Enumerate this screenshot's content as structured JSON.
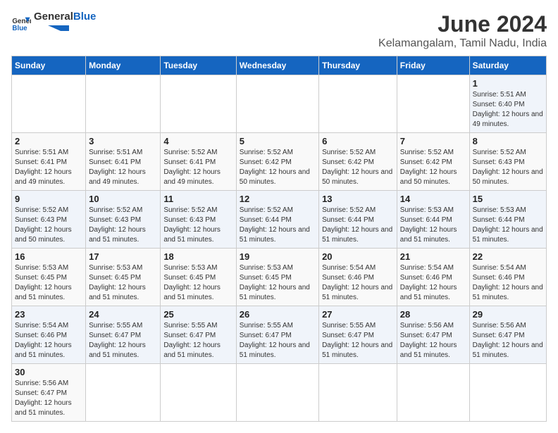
{
  "logo": {
    "text_general": "General",
    "text_blue": "Blue"
  },
  "title": "June 2024",
  "subtitle": "Kelamangalam, Tamil Nadu, India",
  "days_of_week": [
    "Sunday",
    "Monday",
    "Tuesday",
    "Wednesday",
    "Thursday",
    "Friday",
    "Saturday"
  ],
  "weeks": [
    [
      {
        "day": "",
        "info": ""
      },
      {
        "day": "",
        "info": ""
      },
      {
        "day": "",
        "info": ""
      },
      {
        "day": "",
        "info": ""
      },
      {
        "day": "",
        "info": ""
      },
      {
        "day": "",
        "info": ""
      },
      {
        "day": "1",
        "info": "Sunrise: 5:51 AM\nSunset: 6:40 PM\nDaylight: 12 hours and 49 minutes."
      }
    ],
    [
      {
        "day": "2",
        "info": "Sunrise: 5:51 AM\nSunset: 6:41 PM\nDaylight: 12 hours and 49 minutes."
      },
      {
        "day": "3",
        "info": "Sunrise: 5:51 AM\nSunset: 6:41 PM\nDaylight: 12 hours and 49 minutes."
      },
      {
        "day": "4",
        "info": "Sunrise: 5:52 AM\nSunset: 6:41 PM\nDaylight: 12 hours and 49 minutes."
      },
      {
        "day": "5",
        "info": "Sunrise: 5:52 AM\nSunset: 6:42 PM\nDaylight: 12 hours and 50 minutes."
      },
      {
        "day": "6",
        "info": "Sunrise: 5:52 AM\nSunset: 6:42 PM\nDaylight: 12 hours and 50 minutes."
      },
      {
        "day": "7",
        "info": "Sunrise: 5:52 AM\nSunset: 6:42 PM\nDaylight: 12 hours and 50 minutes."
      },
      {
        "day": "8",
        "info": "Sunrise: 5:52 AM\nSunset: 6:43 PM\nDaylight: 12 hours and 50 minutes."
      }
    ],
    [
      {
        "day": "9",
        "info": "Sunrise: 5:52 AM\nSunset: 6:43 PM\nDaylight: 12 hours and 50 minutes."
      },
      {
        "day": "10",
        "info": "Sunrise: 5:52 AM\nSunset: 6:43 PM\nDaylight: 12 hours and 51 minutes."
      },
      {
        "day": "11",
        "info": "Sunrise: 5:52 AM\nSunset: 6:43 PM\nDaylight: 12 hours and 51 minutes."
      },
      {
        "day": "12",
        "info": "Sunrise: 5:52 AM\nSunset: 6:44 PM\nDaylight: 12 hours and 51 minutes."
      },
      {
        "day": "13",
        "info": "Sunrise: 5:52 AM\nSunset: 6:44 PM\nDaylight: 12 hours and 51 minutes."
      },
      {
        "day": "14",
        "info": "Sunrise: 5:53 AM\nSunset: 6:44 PM\nDaylight: 12 hours and 51 minutes."
      },
      {
        "day": "15",
        "info": "Sunrise: 5:53 AM\nSunset: 6:44 PM\nDaylight: 12 hours and 51 minutes."
      }
    ],
    [
      {
        "day": "16",
        "info": "Sunrise: 5:53 AM\nSunset: 6:45 PM\nDaylight: 12 hours and 51 minutes."
      },
      {
        "day": "17",
        "info": "Sunrise: 5:53 AM\nSunset: 6:45 PM\nDaylight: 12 hours and 51 minutes."
      },
      {
        "day": "18",
        "info": "Sunrise: 5:53 AM\nSunset: 6:45 PM\nDaylight: 12 hours and 51 minutes."
      },
      {
        "day": "19",
        "info": "Sunrise: 5:53 AM\nSunset: 6:45 PM\nDaylight: 12 hours and 51 minutes."
      },
      {
        "day": "20",
        "info": "Sunrise: 5:54 AM\nSunset: 6:46 PM\nDaylight: 12 hours and 51 minutes."
      },
      {
        "day": "21",
        "info": "Sunrise: 5:54 AM\nSunset: 6:46 PM\nDaylight: 12 hours and 51 minutes."
      },
      {
        "day": "22",
        "info": "Sunrise: 5:54 AM\nSunset: 6:46 PM\nDaylight: 12 hours and 51 minutes."
      }
    ],
    [
      {
        "day": "23",
        "info": "Sunrise: 5:54 AM\nSunset: 6:46 PM\nDaylight: 12 hours and 51 minutes."
      },
      {
        "day": "24",
        "info": "Sunrise: 5:55 AM\nSunset: 6:47 PM\nDaylight: 12 hours and 51 minutes."
      },
      {
        "day": "25",
        "info": "Sunrise: 5:55 AM\nSunset: 6:47 PM\nDaylight: 12 hours and 51 minutes."
      },
      {
        "day": "26",
        "info": "Sunrise: 5:55 AM\nSunset: 6:47 PM\nDaylight: 12 hours and 51 minutes."
      },
      {
        "day": "27",
        "info": "Sunrise: 5:55 AM\nSunset: 6:47 PM\nDaylight: 12 hours and 51 minutes."
      },
      {
        "day": "28",
        "info": "Sunrise: 5:56 AM\nSunset: 6:47 PM\nDaylight: 12 hours and 51 minutes."
      },
      {
        "day": "29",
        "info": "Sunrise: 5:56 AM\nSunset: 6:47 PM\nDaylight: 12 hours and 51 minutes."
      }
    ],
    [
      {
        "day": "30",
        "info": "Sunrise: 5:56 AM\nSunset: 6:47 PM\nDaylight: 12 hours and 51 minutes."
      },
      {
        "day": "",
        "info": ""
      },
      {
        "day": "",
        "info": ""
      },
      {
        "day": "",
        "info": ""
      },
      {
        "day": "",
        "info": ""
      },
      {
        "day": "",
        "info": ""
      },
      {
        "day": "",
        "info": ""
      }
    ]
  ]
}
